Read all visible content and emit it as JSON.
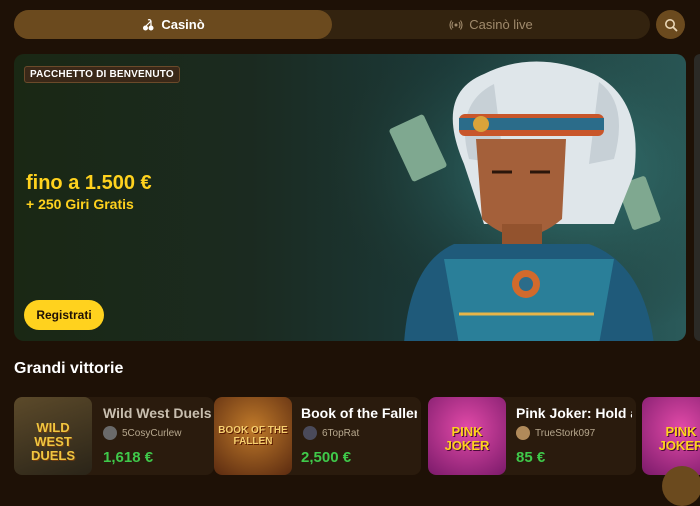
{
  "tabs": [
    {
      "label": "Casinò",
      "icon": "cherries-icon",
      "active": true
    },
    {
      "label": "Casinò live",
      "icon": "live-broadcast-icon",
      "active": false
    }
  ],
  "banner": {
    "badge": "PACCHETTO DI BENVENUTO",
    "headline": "fino a 1.500 €",
    "subline": "+ 250 Giri Gratis",
    "cta": "Registrati"
  },
  "big_wins": {
    "title": "Grandi vittorie",
    "items": [
      {
        "game": "Wild West Duels",
        "user": "5CosyCurlew",
        "amount": "1,618 €",
        "thumb_text": "WILD WEST DUELS"
      },
      {
        "game": "Book of the Fallen",
        "user": "6TopRat",
        "amount": "2,500 €",
        "thumb_text": "BOOK OF THE FALLEN"
      },
      {
        "game": "Pink Joker: Hold and Win",
        "user": "TrueStork097",
        "amount": "85 €",
        "thumb_text": "PINK JOKER"
      },
      {
        "game": "Pink Joker",
        "user": "",
        "amount": "",
        "thumb_text": "PINK JOKER"
      }
    ]
  },
  "colors": {
    "accent": "#ffd21e",
    "win_green": "#3fc94a",
    "background": "#1e1106",
    "tab_active": "#6b4a1e"
  }
}
